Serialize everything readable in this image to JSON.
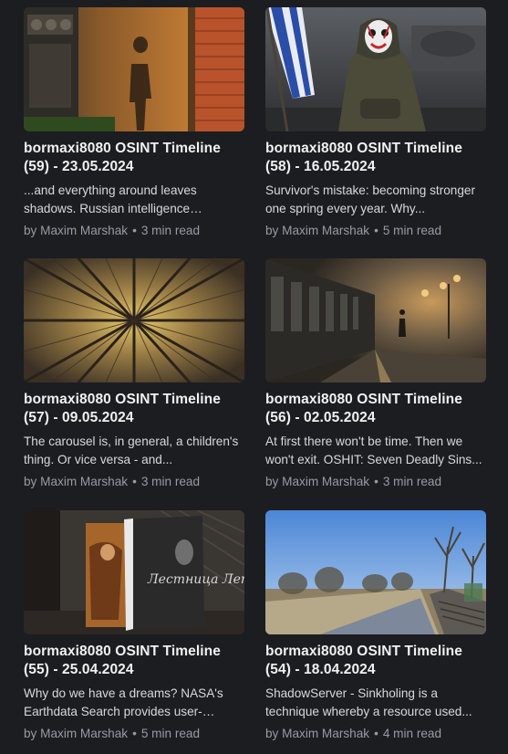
{
  "posts": [
    {
      "title_line1": "bormaxi8080 OSINT Timeline",
      "title_line2": "(59) - 23.05.2024",
      "excerpt": "...and everything around leaves shadows. Russian intelligence services...",
      "author": "by Maxim Marshak",
      "separator": "•",
      "read_time": "3 min read",
      "image": "shadow-on-wooden-wall"
    },
    {
      "title_line1": "bormaxi8080 OSINT Timeline",
      "title_line2": "(58) - 16.05.2024",
      "excerpt": "Survivor's mistake: becoming stronger one spring every year. Why...",
      "author": "by Maxim Marshak",
      "separator": "•",
      "read_time": "5 min read",
      "image": "masked-figure-with-flag"
    },
    {
      "title_line1": "bormaxi8080 OSINT Timeline",
      "title_line2": "(57) - 09.05.2024",
      "excerpt": "The carousel is, in general, a children's thing. Or vice versa - and...",
      "author": "by Maxim Marshak",
      "separator": "•",
      "read_time": "3 min read",
      "image": "looking-up-at-trees"
    },
    {
      "title_line1": "bormaxi8080 OSINT Timeline",
      "title_line2": "(56) - 02.05.2024",
      "excerpt": "At first there won't be time. Then we won't exit. OSHIT: Seven Deadly Sins...",
      "author": "by Maxim Marshak",
      "separator": "•",
      "read_time": "3 min read",
      "image": "train-platform-in-fog"
    },
    {
      "title_line1": "bormaxi8080 OSINT Timeline",
      "title_line2": "(55) - 25.04.2024",
      "excerpt": "Why do we have a dreams? NASA's Earthdata Search provides user-friendly...",
      "author": "by Maxim Marshak",
      "separator": "•",
      "read_time": "5 min read",
      "image": "books-on-table",
      "book_cover_text": "Лестница Летова"
    },
    {
      "title_line1": "bormaxi8080 OSINT Timeline",
      "title_line2": "(54) - 18.04.2024",
      "excerpt": "ShadowServer - Sinkholing is a technique whereby a resource used...",
      "author": "by Maxim Marshak",
      "separator": "•",
      "read_time": "4 min read",
      "image": "park-path-with-stairs"
    }
  ]
}
